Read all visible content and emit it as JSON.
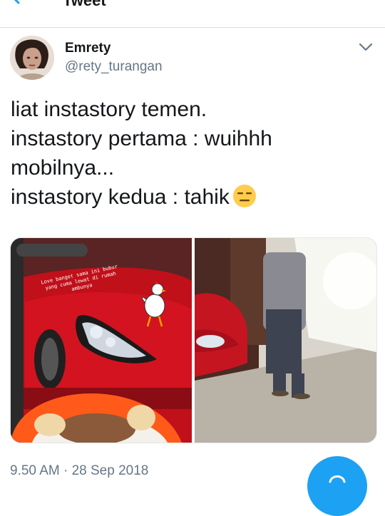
{
  "header": {
    "title": "Tweet"
  },
  "author": {
    "display_name": "Emrety",
    "handle": "@rety_turangan"
  },
  "tweet": {
    "lines": [
      "liat instastory temen.",
      "instastory pertama : wuihhh",
      "mobilnya...",
      "instastory kedua : tahik"
    ],
    "emoji": "expressionless-face-emoji"
  },
  "media": {
    "story_caption": "Love banget sama ini bubur\nyang cuma lewat di rumah\nambunya"
  },
  "timestamp": "9.50 AM · 28 Sep 2018",
  "colors": {
    "accent": "#1da1f2",
    "secondary_text": "#657786",
    "divider": "#d9dde0"
  }
}
